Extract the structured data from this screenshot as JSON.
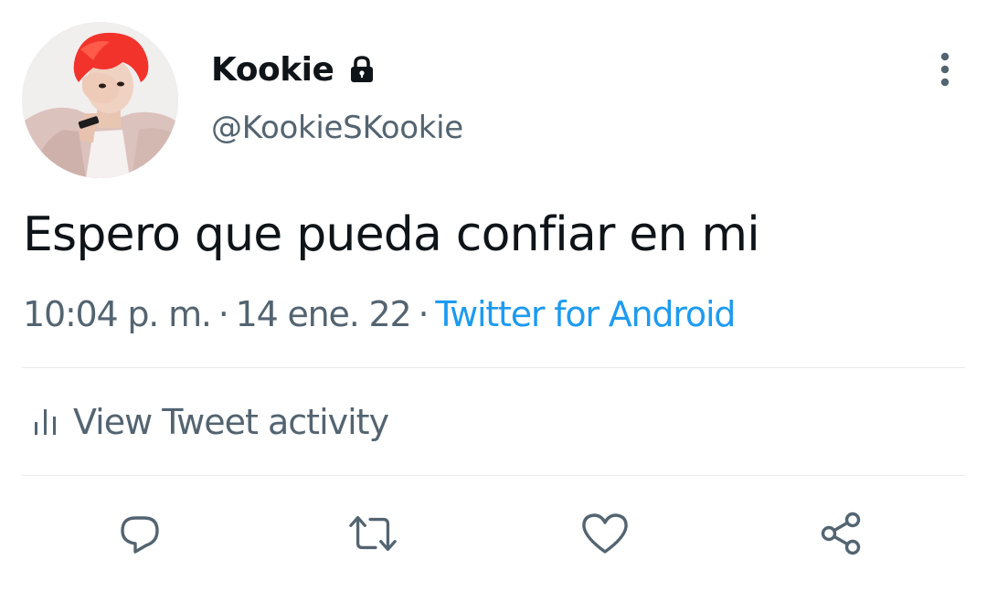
{
  "tweet": {
    "author": {
      "display_name": "Kookie",
      "handle": "@KookieSKookie",
      "protected_icon": "lock-icon",
      "avatar": "avatar-photo"
    },
    "text": "Espero que pueda confiar en mi",
    "meta": {
      "time": "10:04 p. m.",
      "separator": "·",
      "date": "14 ene. 22",
      "source": "Twitter for Android"
    },
    "activity": {
      "icon": "bar-chart-icon",
      "label": "View Tweet activity"
    },
    "more_icon": "more-vertical-icon",
    "actions": [
      {
        "name": "reply",
        "icon": "reply-icon"
      },
      {
        "name": "retweet",
        "icon": "retweet-icon"
      },
      {
        "name": "like",
        "icon": "heart-icon"
      },
      {
        "name": "share",
        "icon": "share-icon"
      }
    ]
  },
  "colors": {
    "text_primary": "#0f1419",
    "text_secondary": "#536471",
    "link": "#1d9bf0",
    "divider": "#e6e9ec",
    "avatar_hair": "#f2332b"
  }
}
